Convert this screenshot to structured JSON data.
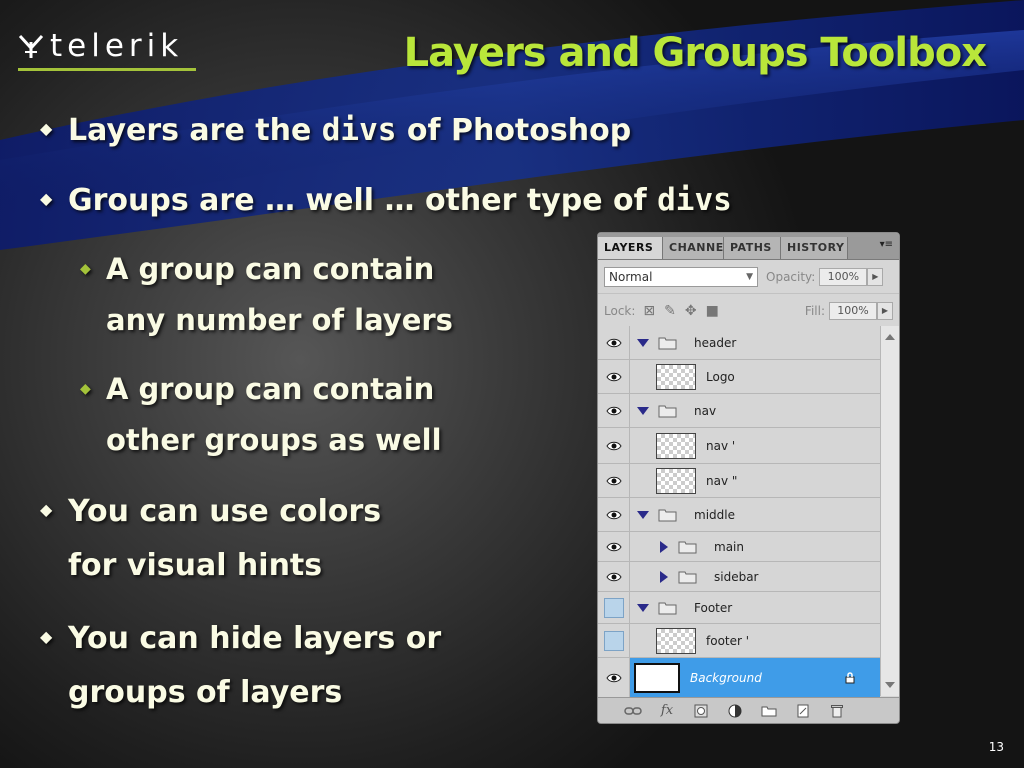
{
  "logo": {
    "text": "telerik"
  },
  "title": "Layers and Groups Toolbox",
  "bullets": {
    "b1": {
      "pre": "Layers are the ",
      "code": "divs",
      "post": " of Photoshop"
    },
    "b2": {
      "pre": "Groups are … well … other type of ",
      "code": "divs"
    },
    "b3": {
      "line1": "A group can contain",
      "line2": "any number of layers"
    },
    "b4": {
      "line1": "A group can contain",
      "line2": "other groups as well"
    },
    "b5": {
      "line1": "You can use colors",
      "line2": "for visual hints"
    },
    "b6": {
      "line1": "You can hide layers or",
      "line2": "groups of layers"
    }
  },
  "panel": {
    "tabs": [
      "LAYERS",
      "CHANNE",
      "PATHS",
      "HISTORY"
    ],
    "blend_mode": "Normal",
    "opacity_label": "Opacity:",
    "opacity_value": "100%",
    "lock_label": "Lock:",
    "fill_label": "Fill:",
    "fill_value": "100%",
    "layers": [
      {
        "name": "header",
        "type": "group-open"
      },
      {
        "name": "Logo",
        "type": "layer"
      },
      {
        "name": "nav",
        "type": "group-open"
      },
      {
        "name": "nav '",
        "type": "layer"
      },
      {
        "name": "nav \"",
        "type": "layer"
      },
      {
        "name": "middle",
        "type": "group-open"
      },
      {
        "name": "main",
        "type": "group-closed"
      },
      {
        "name": "sidebar",
        "type": "group-closed"
      },
      {
        "name": "Footer",
        "type": "group-open",
        "visible": false
      },
      {
        "name": "footer '",
        "type": "layer",
        "visible": false
      },
      {
        "name": "Background",
        "type": "background",
        "selected": true
      }
    ],
    "bottom_icons": [
      "link-icon",
      "fx-icon",
      "mask-icon",
      "adjustment-icon",
      "new-group-icon",
      "new-layer-icon",
      "trash-icon"
    ],
    "bottom_fx_label": "fx"
  },
  "slide_number": "13",
  "colors": {
    "title": "#b9e63a",
    "accent": "#a4c33a",
    "text": "#fafbe4",
    "selected_layer": "#3f9ce8"
  }
}
